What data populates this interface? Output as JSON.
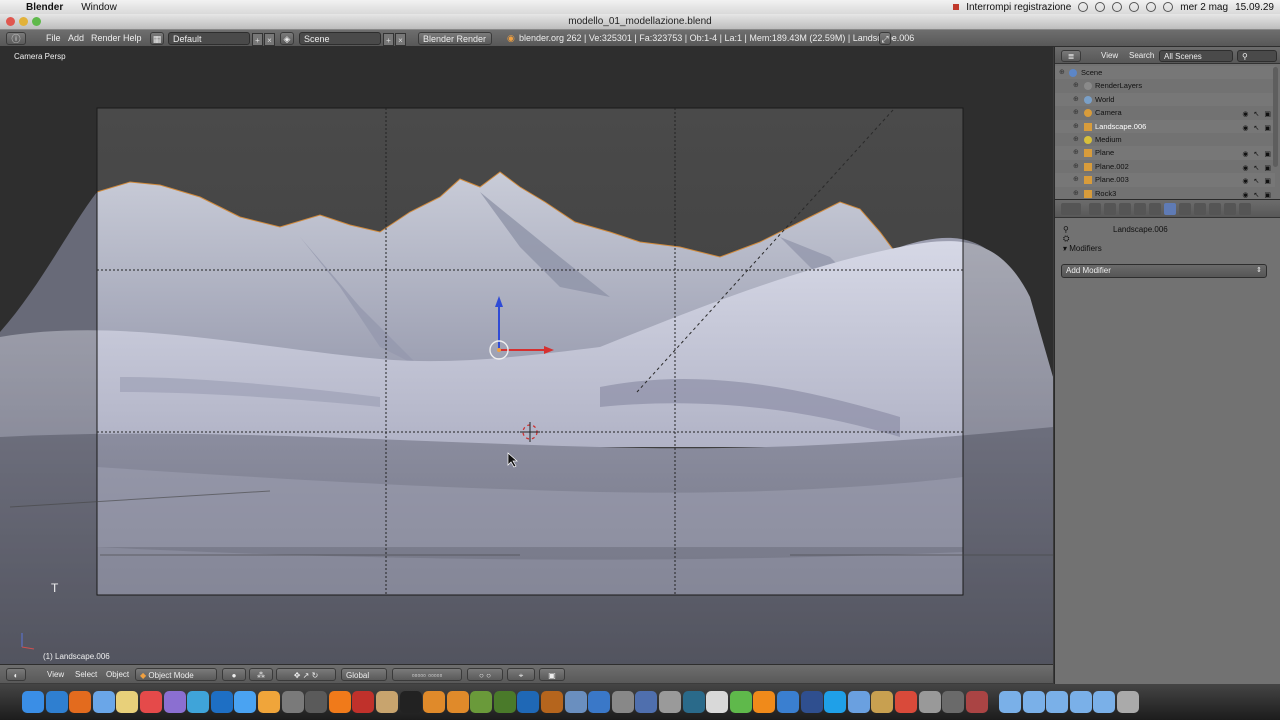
{
  "macbar": {
    "app_name": "Blender",
    "menus": [
      "Window"
    ],
    "status_text": "Interrompi registrazione",
    "date": "mer 2 mag",
    "time": "15.09.29"
  },
  "window": {
    "title": "modello_01_modellazione.blend"
  },
  "header": {
    "menus": [
      "File",
      "Add",
      "Render",
      "Help"
    ],
    "screen_layout": "Default",
    "scene": "Scene",
    "render_engine": "Blender Render",
    "stats": "blender.org 262 | Ve:325301 | Fa:323753 | Ob:1-4 | La:1 | Mem:189.43M (22.59M) | Landscape.006"
  },
  "viewport": {
    "view_label": "Camera Persp",
    "active_object": "(1) Landscape.006",
    "tool_hint": "T"
  },
  "vp_header": {
    "menus": [
      "View",
      "Select",
      "Object"
    ],
    "mode": "Object Mode",
    "orientation": "Global"
  },
  "outliner": {
    "menus": [
      "View",
      "Search"
    ],
    "filter": "All Scenes",
    "items": [
      {
        "name": "Scene",
        "icon": "scene-icon",
        "color": "#5c86c7",
        "level": 0
      },
      {
        "name": "RenderLayers",
        "icon": "render-layers-icon",
        "color": "#8a8a8a",
        "level": 1
      },
      {
        "name": "World",
        "icon": "world-icon",
        "color": "#7aa0c8",
        "level": 1
      },
      {
        "name": "Camera",
        "icon": "camera-icon",
        "color": "#d89c3b",
        "level": 1
      },
      {
        "name": "Landscape.006",
        "icon": "mesh-icon",
        "color": "#d89c3b",
        "level": 1,
        "selected": true
      },
      {
        "name": "Medium",
        "icon": "lamp-icon",
        "color": "#d8c03b",
        "level": 1
      },
      {
        "name": "Plane",
        "icon": "mesh-icon",
        "color": "#d89c3b",
        "level": 1
      },
      {
        "name": "Plane.002",
        "icon": "mesh-icon",
        "color": "#d89c3b",
        "level": 1
      },
      {
        "name": "Plane.003",
        "icon": "mesh-icon",
        "color": "#d89c3b",
        "level": 1
      },
      {
        "name": "Rock3",
        "icon": "mesh-icon",
        "color": "#d89c3b",
        "level": 1
      }
    ]
  },
  "properties": {
    "object_path": "Landscape.006",
    "panel_title": "Modifiers",
    "add_modifier_label": "Add Modifier"
  },
  "dock": {
    "icons": [
      "finder-icon",
      "app-store-icon",
      "firefox-icon",
      "mail-icon",
      "notes-icon",
      "calendar-icon",
      "photo-icon",
      "preview-icon",
      "quicktime-icon",
      "itunes-icon",
      "photos-icon",
      "font-icon",
      "timeline-icon",
      "vlc-icon",
      "filezilla-icon",
      "box-icon",
      "terminal-icon",
      "blender-icon",
      "blender-icon",
      "editor-icon",
      "editor-icon",
      "photoshop-icon",
      "bridge-icon",
      "image-icon",
      "globe-icon",
      "gear-icon",
      "ship-icon",
      "disk-utility-icon",
      "time-machine-icon",
      "document-icon",
      "cube-icon",
      "cone-icon",
      "chart-icon",
      "grapher-icon",
      "skype-icon",
      "folder-icon",
      "archive-icon",
      "pdf-icon",
      "zip-icon",
      "tool-icon",
      "lock-icon",
      "folder-icon",
      "folder-icon",
      "folder-icon",
      "folder-icon",
      "folder-icon",
      "trash-icon"
    ]
  }
}
